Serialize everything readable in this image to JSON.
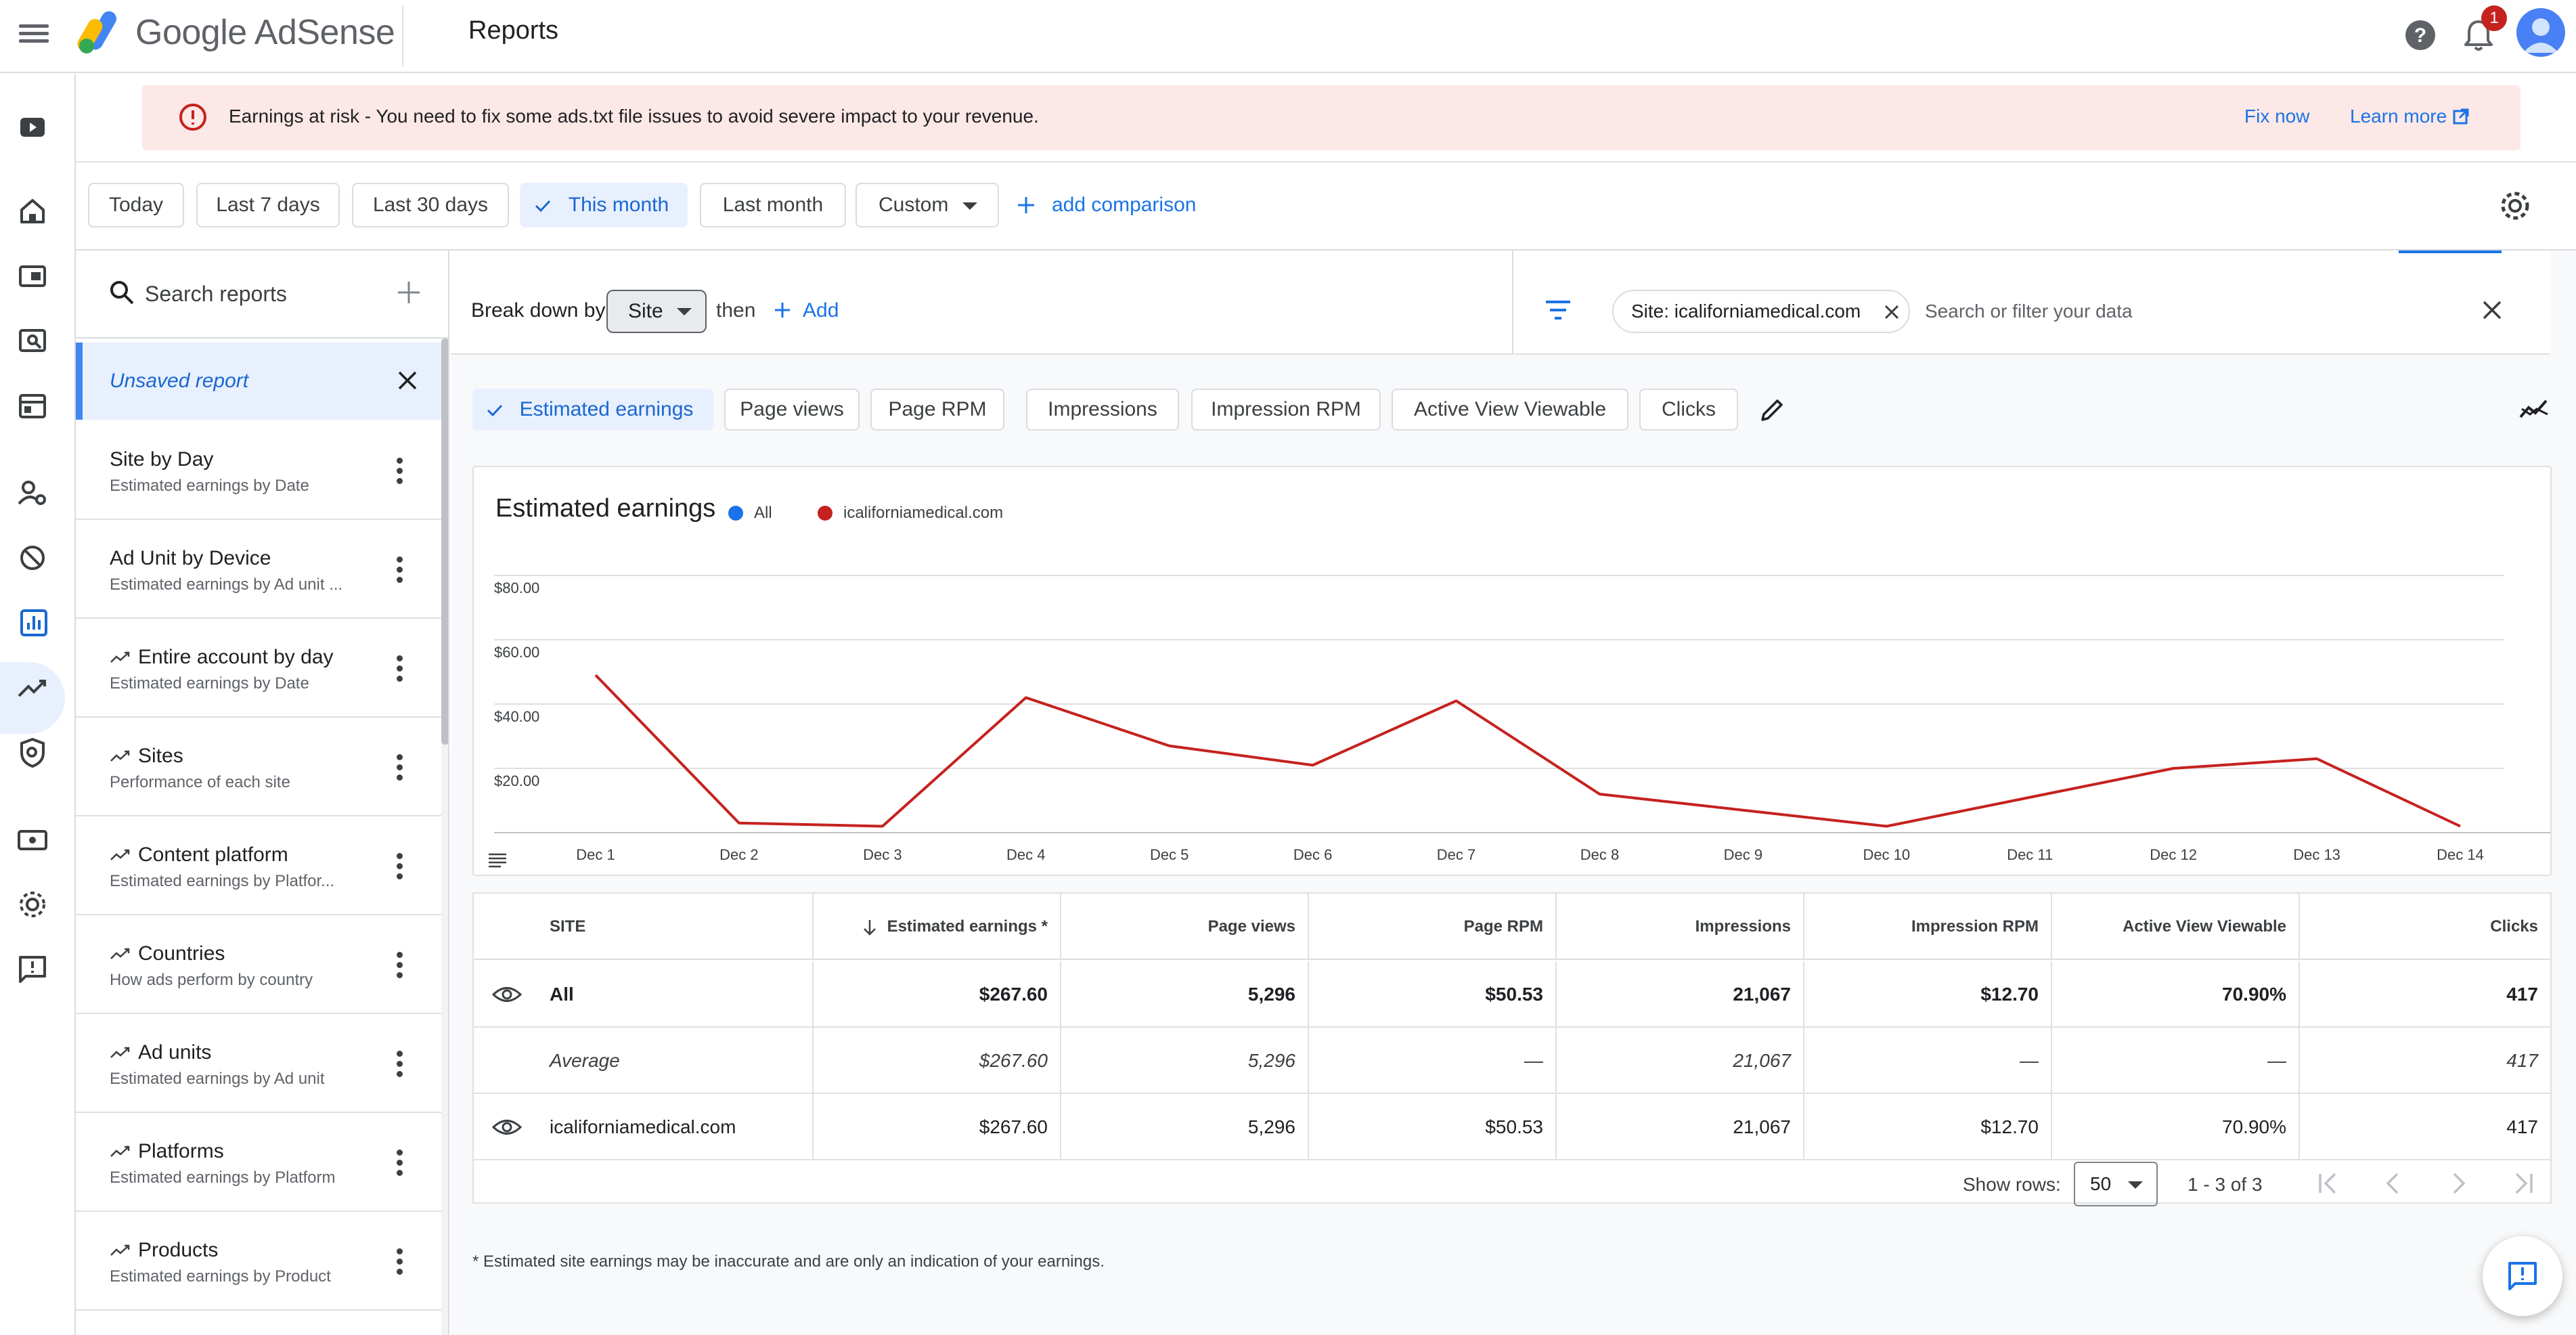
{
  "app": {
    "name": "Google AdSense",
    "page_title": "Reports",
    "notification_count": "1"
  },
  "alert": {
    "message": "Earnings at risk - You need to fix some ads.txt file issues to avoid severe impact to your revenue.",
    "fix_label": "Fix now",
    "learn_label": "Learn more"
  },
  "date_ranges": [
    {
      "label": "Today"
    },
    {
      "label": "Last 7 days"
    },
    {
      "label": "Last 30 days"
    },
    {
      "label": "This month",
      "active": true
    },
    {
      "label": "Last month"
    },
    {
      "label": "Custom"
    }
  ],
  "add_comparison": "add comparison",
  "sidebar": {
    "search_placeholder": "Search reports",
    "unsaved_label": "Unsaved report",
    "reports": [
      {
        "title": "Site by Day",
        "subtitle": "Estimated earnings by Date",
        "auto": false
      },
      {
        "title": "Ad Unit by Device",
        "subtitle": "Estimated earnings by Ad unit ...",
        "auto": false
      },
      {
        "title": "Entire account by day",
        "subtitle": "Estimated earnings by Date",
        "auto": true
      },
      {
        "title": "Sites",
        "subtitle": "Performance of each site",
        "auto": true
      },
      {
        "title": "Content platform",
        "subtitle": "Estimated earnings by Platfor...",
        "auto": true
      },
      {
        "title": "Countries",
        "subtitle": "How ads perform by country",
        "auto": true
      },
      {
        "title": "Ad units",
        "subtitle": "Estimated earnings by Ad unit",
        "auto": true
      },
      {
        "title": "Platforms",
        "subtitle": "Estimated earnings by Platform",
        "auto": true
      },
      {
        "title": "Products",
        "subtitle": "Estimated earnings by Product",
        "auto": true
      }
    ]
  },
  "breakdown": {
    "label": "Break down by",
    "selected": "Site",
    "then_label": "then",
    "add_label": "Add",
    "filter_chip": "Site: icaliforniamedical.com",
    "filter_placeholder": "Search or filter your data"
  },
  "metrics": [
    {
      "label": "Estimated earnings",
      "active": true
    },
    {
      "label": "Page views"
    },
    {
      "label": "Page RPM"
    },
    {
      "label": "Impressions"
    },
    {
      "label": "Impression RPM"
    },
    {
      "label": "Active View Viewable"
    },
    {
      "label": "Clicks"
    }
  ],
  "chart_data": {
    "type": "line",
    "title": "Estimated earnings",
    "legend": [
      {
        "name": "All",
        "color": "#1a73e8"
      },
      {
        "name": "icaliforniamedical.com",
        "color": "#c5221f"
      }
    ],
    "x": [
      "Dec 1",
      "Dec 2",
      "Dec 3",
      "Dec 4",
      "Dec 5",
      "Dec 6",
      "Dec 7",
      "Dec 8",
      "Dec 9",
      "Dec 10",
      "Dec 11",
      "Dec 12",
      "Dec 13",
      "Dec 14"
    ],
    "series": [
      {
        "name": "icaliforniamedical.com",
        "color": "#c5221f",
        "values": [
          49,
          3,
          2,
          42,
          27,
          21,
          41,
          12,
          7,
          2,
          11,
          20,
          23,
          2
        ]
      }
    ],
    "yticks": [
      "$20.00",
      "$40.00",
      "$60.00",
      "$80.00"
    ],
    "ylim": [
      0,
      80
    ],
    "grid": true
  },
  "table": {
    "columns": [
      "SITE",
      "Estimated earnings *",
      "Page views",
      "Page RPM",
      "Impressions",
      "Impression RPM",
      "Active View Viewable",
      "Clicks"
    ],
    "rows": [
      {
        "kind": "total",
        "cells": [
          "All",
          "$267.60",
          "5,296",
          "$50.53",
          "21,067",
          "$12.70",
          "70.90%",
          "417"
        ]
      },
      {
        "kind": "average",
        "cells": [
          "Average",
          "$267.60",
          "5,296",
          "—",
          "21,067",
          "—",
          "—",
          "417"
        ]
      },
      {
        "kind": "site",
        "cells": [
          "icaliforniamedical.com",
          "$267.60",
          "5,296",
          "$50.53",
          "21,067",
          "$12.70",
          "70.90%",
          "417"
        ]
      }
    ],
    "show_rows_label": "Show rows:",
    "rows_per_page": "50",
    "range_label": "1 - 3 of 3"
  },
  "footnote": "* Estimated site earnings may be inaccurate and are only an indication of your earnings."
}
